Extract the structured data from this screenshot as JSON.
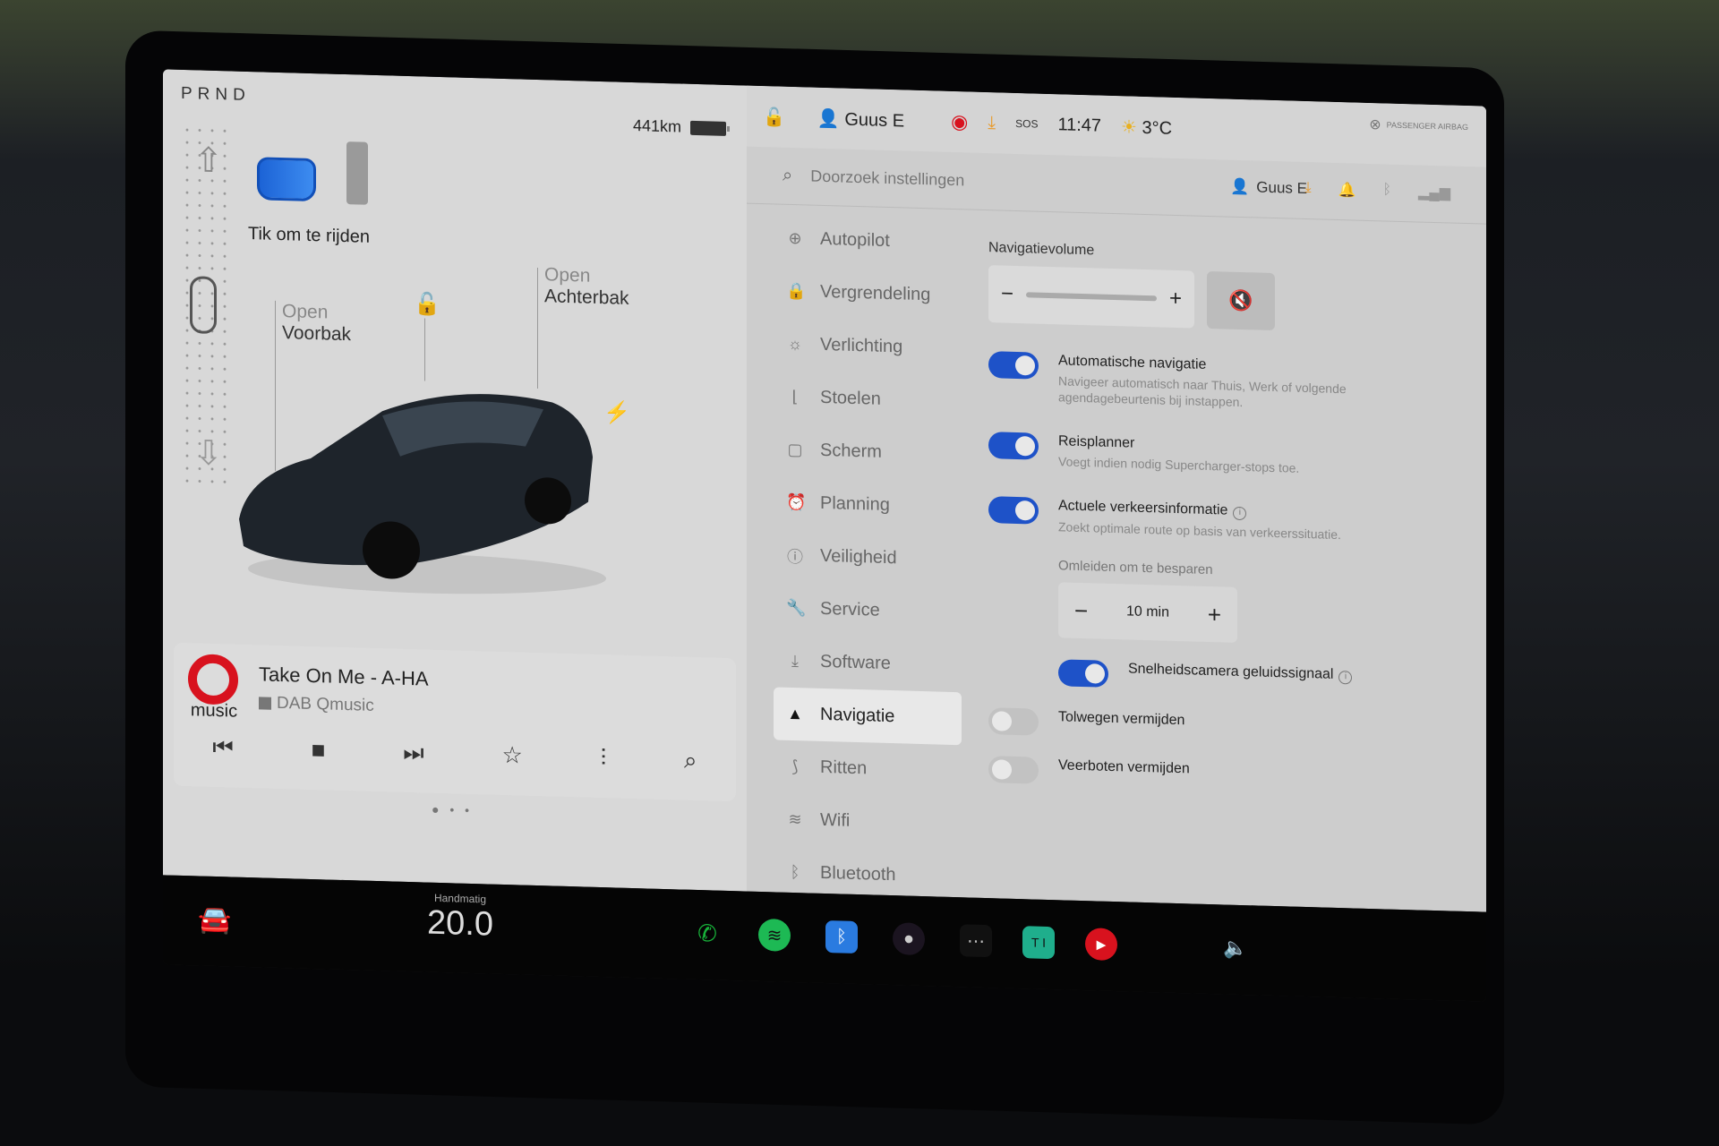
{
  "drive": {
    "gears": "PRND",
    "range": "441km",
    "tap_to_drive": "Tik om te rijden",
    "frunk": {
      "action": "Open",
      "label": "Voorbak"
    },
    "trunk": {
      "action": "Open",
      "label": "Achterbak"
    }
  },
  "topbar": {
    "user": "Guus E",
    "time": "11:47",
    "temperature": "3°C",
    "sos": "SOS",
    "airbag": "PASSENGER AIRBAG"
  },
  "settings": {
    "search_placeholder": "Doorzoek instellingen",
    "profile": "Guus E",
    "menu": [
      {
        "label": "Autopilot",
        "icon": "steering-wheel-icon"
      },
      {
        "label": "Vergrendeling",
        "icon": "lock-icon"
      },
      {
        "label": "Verlichting",
        "icon": "light-icon"
      },
      {
        "label": "Stoelen",
        "icon": "seat-icon"
      },
      {
        "label": "Scherm",
        "icon": "display-icon"
      },
      {
        "label": "Planning",
        "icon": "alarm-icon"
      },
      {
        "label": "Veiligheid",
        "icon": "alert-icon"
      },
      {
        "label": "Service",
        "icon": "wrench-icon"
      },
      {
        "label": "Software",
        "icon": "download-icon"
      },
      {
        "label": "Navigatie",
        "icon": "navigation-icon",
        "active": true
      },
      {
        "label": "Ritten",
        "icon": "trips-icon"
      },
      {
        "label": "Wifi",
        "icon": "wifi-icon"
      },
      {
        "label": "Bluetooth",
        "icon": "bluetooth-icon"
      }
    ],
    "nav_volume_label": "Navigatievolume",
    "nav_volume_level": 0.0,
    "options": {
      "auto_nav": {
        "title": "Automatische navigatie",
        "desc": "Navigeer automatisch naar Thuis, Werk of volgende agendagebeurtenis bij instappen.",
        "on": true
      },
      "trip_planner": {
        "title": "Reisplanner",
        "desc": "Voegt indien nodig Supercharger-stops toe.",
        "on": true
      },
      "traffic": {
        "title": "Actuele verkeersinformatie",
        "desc": "Zoekt optimale route op basis van verkeerssituatie.",
        "on": true
      },
      "detour_label": "Omleiden om te besparen",
      "detour_value": "10 min",
      "speed_camera": {
        "title": "Snelheidscamera geluidssignaal",
        "on": true
      },
      "avoid_tolls": {
        "title": "Tolwegen vermijden",
        "on": false
      },
      "avoid_ferries": {
        "title": "Veerboten vermijden",
        "on": false
      }
    }
  },
  "media": {
    "logo_text": "music",
    "song": "Take On Me - A-HA",
    "station": "DAB Qmusic"
  },
  "climate": {
    "mode": "Handmatig",
    "temperature": "20.0"
  },
  "colors": {
    "accent": "#1e52c8",
    "record": "#d8121e",
    "download": "#e89a2a"
  }
}
